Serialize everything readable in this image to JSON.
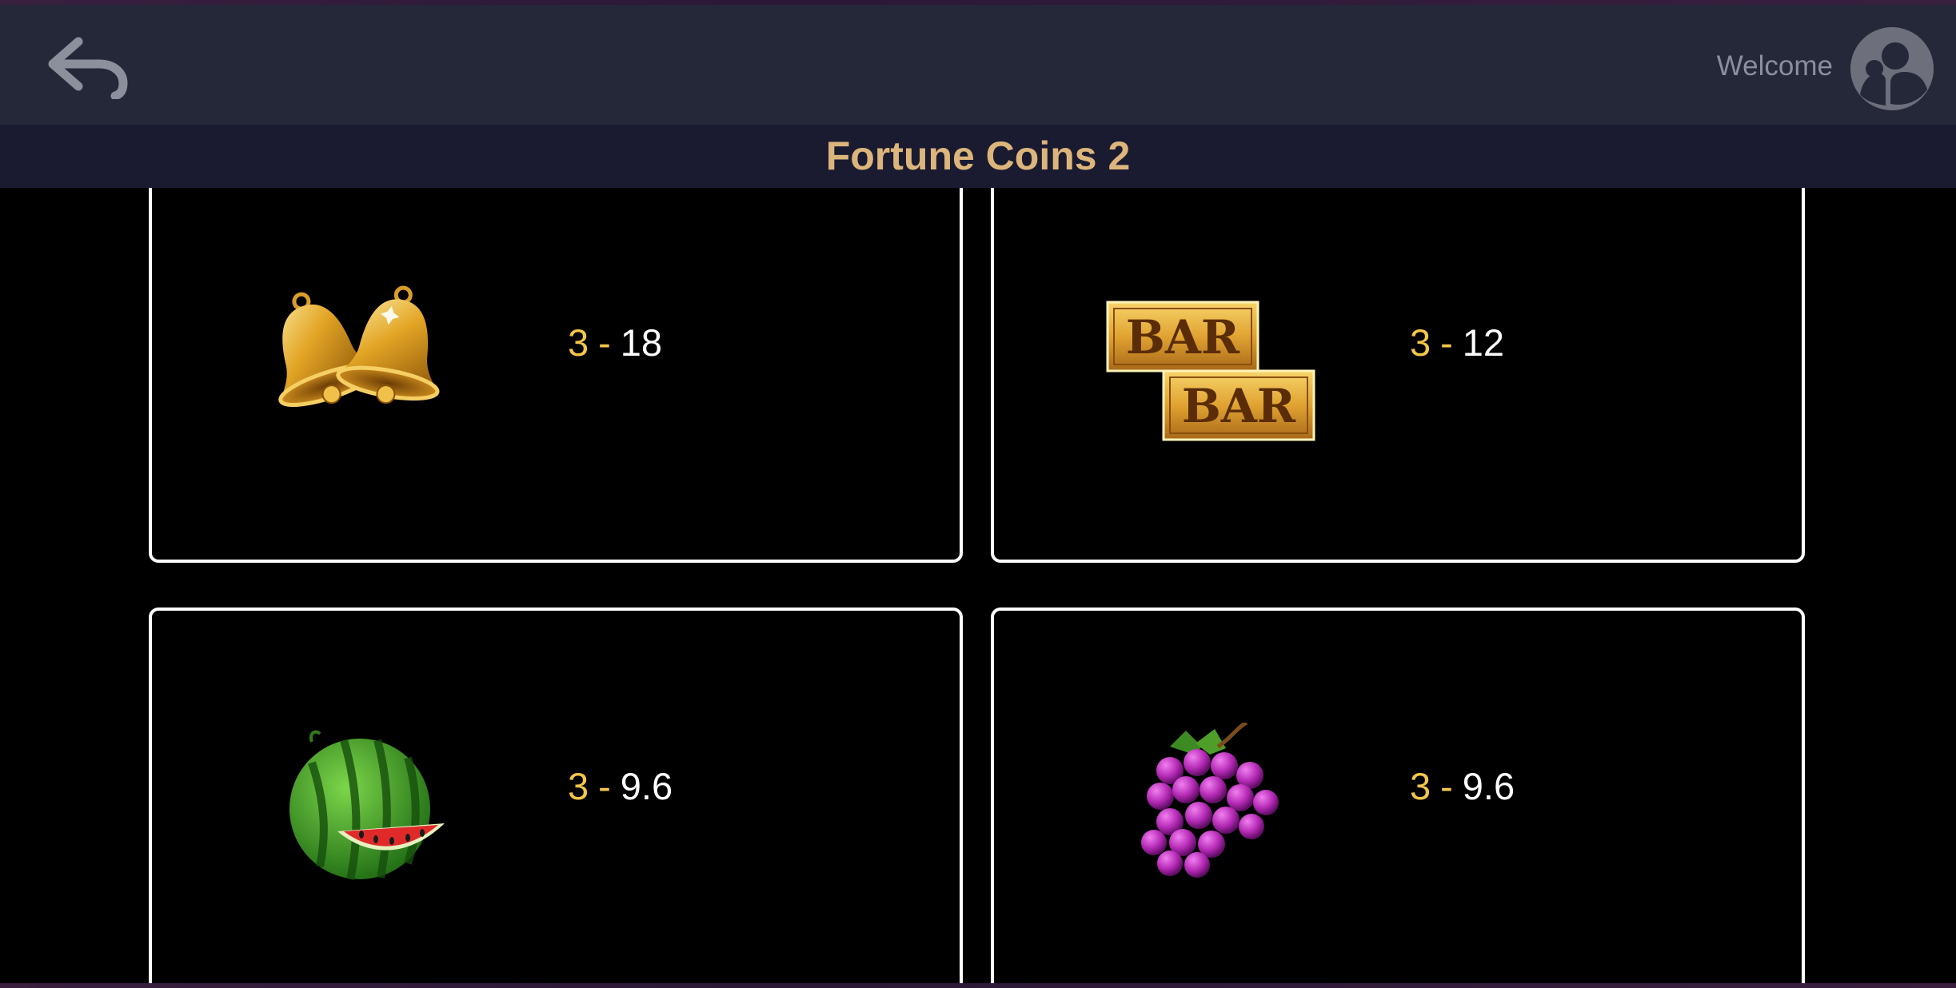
{
  "header": {
    "back_icon": "back-arrow-icon",
    "welcome_text": "Welcome",
    "avatar_icon": "user-avatar-icon"
  },
  "game": {
    "title": "Fortune Coins 2"
  },
  "paytable": [
    {
      "symbol": "bells",
      "icon": "golden-bells-icon",
      "count": "3",
      "separator": "-",
      "payout": "18"
    },
    {
      "symbol": "bar",
      "icon": "double-bar-icon",
      "count": "3",
      "separator": "-",
      "payout": "12",
      "bar_text": "BAR"
    },
    {
      "symbol": "watermelon",
      "icon": "watermelon-icon",
      "count": "3",
      "separator": "-",
      "payout": "9.6"
    },
    {
      "symbol": "grapes",
      "icon": "grapes-icon",
      "count": "3",
      "separator": "-",
      "payout": "9.6"
    }
  ],
  "colors": {
    "header_bg": "#252839",
    "title_bar_bg": "#1a1b30",
    "title_color": "#dcb57c",
    "count_color": "#f3c64a",
    "card_border": "#ffffff"
  }
}
